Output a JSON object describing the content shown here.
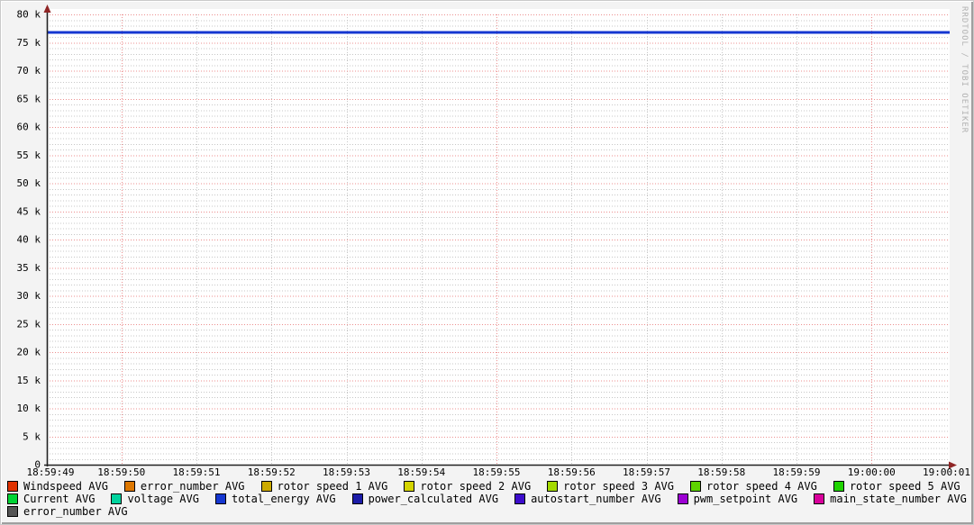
{
  "watermark": "RRDTOOL / TOBI OETIKER",
  "colors": {
    "background": "#f3f3f3",
    "plot_canvas": "#ffffff",
    "axis": "#222222",
    "axis_arrow": "#8f2525",
    "major_grid": "#ec8f8f",
    "minor_grid": "#c7c7c7",
    "tick_text": "#000000"
  },
  "chart_data": {
    "type": "line",
    "title": "",
    "xlabel": "",
    "ylabel": "",
    "grid": true,
    "legend_position": "bottom",
    "ylim": [
      0,
      80000
    ],
    "x_labels": [
      "18:59:49",
      "18:59:50",
      "18:59:51",
      "18:59:52",
      "18:59:53",
      "18:59:54",
      "18:59:55",
      "18:59:56",
      "18:59:57",
      "18:59:58",
      "18:59:59",
      "19:00:00",
      "19:00:01"
    ],
    "x_major_gridlines": [
      "18:59:50",
      "18:59:55",
      "19:00:00"
    ],
    "y_ticks": [
      {
        "value": 0,
        "label": "0"
      },
      {
        "value": 5000,
        "label": "5 k"
      },
      {
        "value": 10000,
        "label": "10 k"
      },
      {
        "value": 15000,
        "label": "15 k"
      },
      {
        "value": 20000,
        "label": "20 k"
      },
      {
        "value": 25000,
        "label": "25 k"
      },
      {
        "value": 30000,
        "label": "30 k"
      },
      {
        "value": 35000,
        "label": "35 k"
      },
      {
        "value": 40000,
        "label": "40 k"
      },
      {
        "value": 45000,
        "label": "45 k"
      },
      {
        "value": 50000,
        "label": "50 k"
      },
      {
        "value": 55000,
        "label": "55 k"
      },
      {
        "value": 60000,
        "label": "60 k"
      },
      {
        "value": 65000,
        "label": "65 k"
      },
      {
        "value": 70000,
        "label": "70 k"
      },
      {
        "value": 75000,
        "label": "75 k"
      },
      {
        "value": 80000,
        "label": "80 k"
      }
    ],
    "y_minor_step": 1000,
    "series": [
      {
        "name": "Windspeed AVG",
        "color": "#e03100",
        "value": null
      },
      {
        "name": "error_number AVG",
        "color": "#dd7700",
        "value": null
      },
      {
        "name": "rotor speed 1 AVG",
        "color": "#ccaa00",
        "value": null
      },
      {
        "name": "rotor speed 2 AVG",
        "color": "#d4d400",
        "value": null
      },
      {
        "name": "rotor speed 3 AVG",
        "color": "#a3d900",
        "value": null
      },
      {
        "name": "rotor speed 4 AVG",
        "color": "#5ed300",
        "value": null
      },
      {
        "name": "rotor speed 5 AVG",
        "color": "#1fd300",
        "value": null
      },
      {
        "name": "Current AVG",
        "color": "#00d335",
        "value": null
      },
      {
        "name": "voltage AVG",
        "color": "#00d39e",
        "value": null
      },
      {
        "name": "total_energy AVG",
        "color": "#1537d1",
        "value": 76800,
        "line_width": 3
      },
      {
        "name": "power_calculated AVG",
        "color": "#1c1ca8",
        "value": null
      },
      {
        "name": "autostart_number AVG",
        "color": "#3d0ccc",
        "value": null
      },
      {
        "name": "pwm_setpoint AVG",
        "color": "#9c00d3",
        "value": null
      },
      {
        "name": "main_state_number AVG",
        "color": "#d9009c",
        "value": null
      },
      {
        "name": "error_number AVG",
        "color": "#555555",
        "value": null
      }
    ],
    "legend_rows": [
      [
        0,
        1,
        2,
        3,
        4,
        5,
        6
      ],
      [
        7,
        8,
        9,
        10,
        11,
        12,
        13
      ],
      [
        14
      ]
    ]
  }
}
